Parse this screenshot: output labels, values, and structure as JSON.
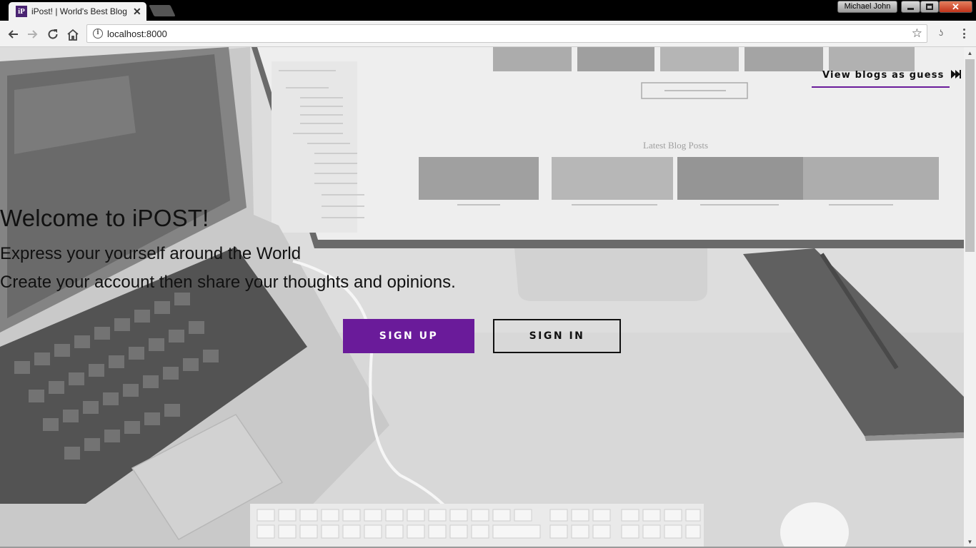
{
  "browser": {
    "tab_title": "iPost! | World's Best Blog",
    "tab_favicon_letters": "iP",
    "profile_name": "Michael John",
    "url": "localhost:8000"
  },
  "page": {
    "guest_link": "View blogs as guess",
    "welcome_title": "Welcome to iPOST!",
    "subtitle_line1": "Express your yourself around the World",
    "subtitle_line2": "Create your account then share your thoughts and opinions.",
    "signup_label": "SIGN UP",
    "signin_label": "SIGN IN"
  },
  "colors": {
    "accent": "#6a1b9a",
    "chrome_dark": "#000000",
    "toolbar": "#f2f2f2"
  },
  "icons": [
    "back-arrow-icon",
    "forward-arrow-icon",
    "reload-icon",
    "home-icon",
    "info-icon",
    "bookmark-star-icon",
    "extension-icon",
    "menu-icon",
    "fast-forward-icon",
    "close-icon"
  ]
}
